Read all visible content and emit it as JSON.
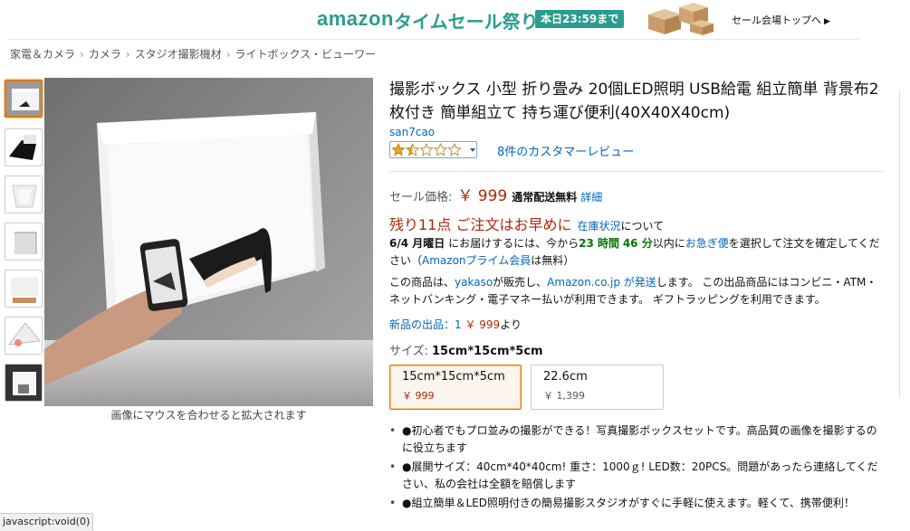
{
  "banner": {
    "logo": "amazon",
    "sale_title": "タイムセール祭り",
    "deadline": "本日23:59まで",
    "top_link": "セール会場トップへ"
  },
  "breadcrumb": [
    "家電＆カメラ",
    "カメラ",
    "スタジオ撮影機材",
    "ライトボックス・ビューワー"
  ],
  "gallery": {
    "thumbnail_count": 7,
    "active_index": 0,
    "caption": "画像にマウスを合わせると拡大されます"
  },
  "product": {
    "title": "撮影ボックス 小型 折り畳み 20個LED照明 USB給電 組立簡単 背景布2枚付き 簡単組立て 持ち運び便利(40X40X40cm)",
    "brand": "san7cao",
    "rating": 1.5,
    "rating_max": 5,
    "review_link": "8件のカスタマーレビュー",
    "price_label": "セール価格:",
    "price": "￥ 999",
    "shipping": "通常配送無料",
    "details_link": "詳細",
    "stock_text": "残り11点 ご注文はお早めに",
    "stock_link": "在庫状況",
    "stock_suffix": "について",
    "delivery": {
      "date": "6/4 月曜日",
      "part1": " にお届けするには、今から",
      "hours": "23 時間",
      "minutes": "46 分",
      "part2": "以内に",
      "express": "お急ぎ便",
      "part3": "を選択して注文を確定してください（",
      "prime": "Amazonプライム会員",
      "part4": "は無料）"
    },
    "seller": {
      "part1": "この商品は、",
      "seller_name": "yakaso",
      "part2": "が販売し、",
      "shipper": "Amazon.co.jp が発送",
      "part3": "します。 この出品商品にはコンビニ・ATM・ネットバンキング・電子マネー払いが利用できます。 ギフトラッピングを利用できます。"
    },
    "new_offers": {
      "label": "新品の出品：1",
      "price": "￥ 999",
      "suffix": "より"
    },
    "size_label": "サイズ:",
    "size_value": "15cm*15cm*5cm",
    "variants": [
      {
        "name": "15cm*15cm*5cm",
        "price": "￥ 999",
        "selected": true
      },
      {
        "name": "22.6cm",
        "price": "￥ 1,399",
        "selected": false
      }
    ],
    "bullets": [
      "●初心者でもプロ並みの撮影ができる！写真撮影ボックスセットです。高品質の画像を撮影するのに役立ちます",
      "●展開サイズ：40cm*40*40cm! 重さ：1000ｇ! LED数：20PCS。問題があったら連絡してください、私の会社は全額を賠償します",
      "●組立簡単＆LED照明付きの簡易撮影スタジオがすぐに手軽に使えます。軽くて、携帯便利！"
    ]
  },
  "status_bar": "javascript:void(0)",
  "colors": {
    "brand_teal": "#2a9d8f",
    "link": "#0066c0",
    "price_red": "#b12704",
    "accent_orange": "#e77600",
    "green": "#007600"
  }
}
